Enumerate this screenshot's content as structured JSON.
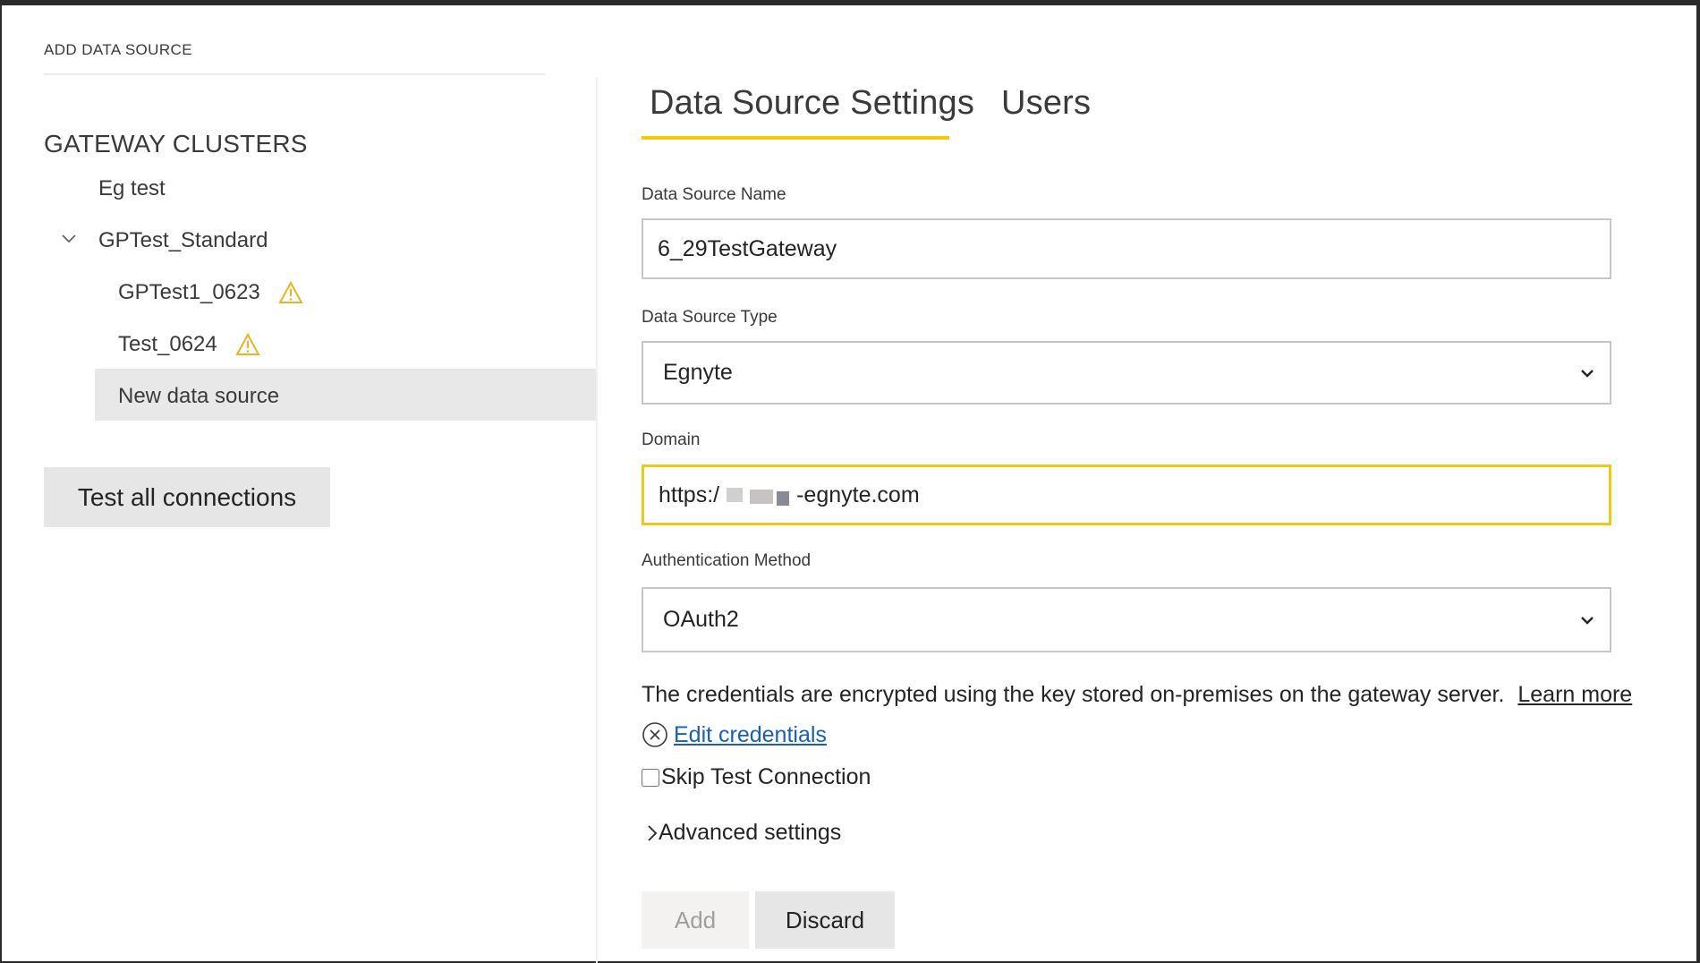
{
  "breadcrumb": "ADD DATA SOURCE",
  "sidebar": {
    "title": "GATEWAY CLUSTERS",
    "items": [
      {
        "label": "Eg test"
      },
      {
        "label": "GPTest_Standard",
        "expanded": true
      },
      {
        "label": "GPTest1_0623",
        "status_icon": "warning-icon"
      },
      {
        "label": "Test_0624",
        "status_icon": "warning-icon"
      },
      {
        "label": "New data source",
        "selected": true
      }
    ],
    "test_all_label": "Test all connections"
  },
  "tabs": [
    {
      "label": "Data Source Settings",
      "active": true
    },
    {
      "label": "Users",
      "active": false
    }
  ],
  "form": {
    "name_label": "Data Source Name",
    "name_value": "6_29TestGateway",
    "type_label": "Data Source Type",
    "type_value": "Egnyte",
    "domain_label": "Domain",
    "domain_value_prefix": "https:/",
    "domain_value_suffix": "-egnyte.com",
    "auth_label": "Authentication Method",
    "auth_value": "OAuth2",
    "note": "The credentials are encrypted using the key stored on-premises on the gateway server.",
    "learn_more": "Learn more",
    "edit_credentials": "Edit credentials",
    "skip_test": "Skip Test Connection",
    "skip_test_checked": false,
    "advanced": "Advanced settings"
  },
  "actions": {
    "add_label": "Add",
    "add_enabled": false,
    "discard_label": "Discard"
  },
  "colors": {
    "accent": "#f2c811",
    "link": "#1a5fb4",
    "warning": "#e8b325"
  }
}
